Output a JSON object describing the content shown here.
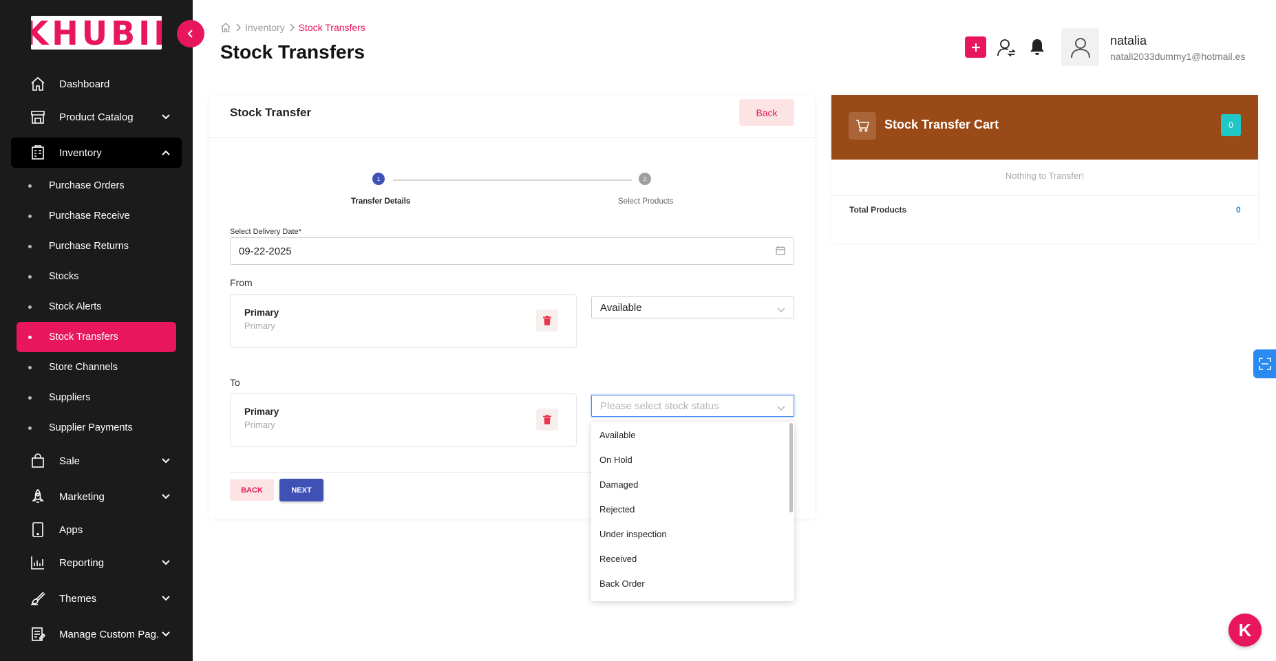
{
  "app": {
    "logo_text": "KHUBII",
    "accent": "#e8175d"
  },
  "sidebar": {
    "items": [
      {
        "label": "Dashboard",
        "icon": "home-icon"
      },
      {
        "label": "Product Catalog",
        "icon": "store-icon"
      },
      {
        "label": "Inventory",
        "icon": "inventory-icon"
      },
      {
        "label": "Sale",
        "icon": "bag-icon"
      },
      {
        "label": "Marketing",
        "icon": "rocket-icon"
      },
      {
        "label": "Apps",
        "icon": "tablet-icon"
      },
      {
        "label": "Reporting",
        "icon": "bar-chart-icon"
      },
      {
        "label": "Themes",
        "icon": "brush-icon"
      },
      {
        "label": "Manage Custom Pag...",
        "icon": "page-icon"
      }
    ],
    "inventory_sub": [
      "Purchase Orders",
      "Purchase Receive",
      "Purchase Returns",
      "Stocks",
      "Stock Alerts",
      "Stock Transfers",
      "Store Channels",
      "Suppliers",
      "Supplier Payments"
    ]
  },
  "breadcrumb": {
    "parent": "Inventory",
    "current": "Stock Transfers"
  },
  "page_title": "Stock Transfers",
  "user": {
    "name": "natalia",
    "email": "natali2033dummy1@hotmail.es"
  },
  "form": {
    "title": "Stock Transfer",
    "back_label": "Back",
    "steps": [
      {
        "num": "1",
        "label": "Transfer Details",
        "active": true
      },
      {
        "num": "2",
        "label": "Select Products",
        "active": false
      }
    ],
    "date_label": "Select Delivery Date*",
    "date_value": "09-22-2025",
    "from_label": "From",
    "from_location": {
      "name": "Primary",
      "sub": "Primary"
    },
    "from_status": "Available",
    "to_label": "To",
    "to_location": {
      "name": "Primary",
      "sub": "Primary"
    },
    "to_status_placeholder": "Please select stock status",
    "status_options": [
      "Available",
      "On Hold",
      "Damaged",
      "Rejected",
      "Under inspection",
      "Received",
      "Back Order"
    ],
    "back_btn": "BACK",
    "next_btn": "NEXT"
  },
  "cart": {
    "title": "Stock Transfer Cart",
    "count": "0",
    "empty_text": "Nothing to Transfer!",
    "total_label": "Total Products",
    "total_value": "0",
    "header_color": "#9a4a16"
  }
}
